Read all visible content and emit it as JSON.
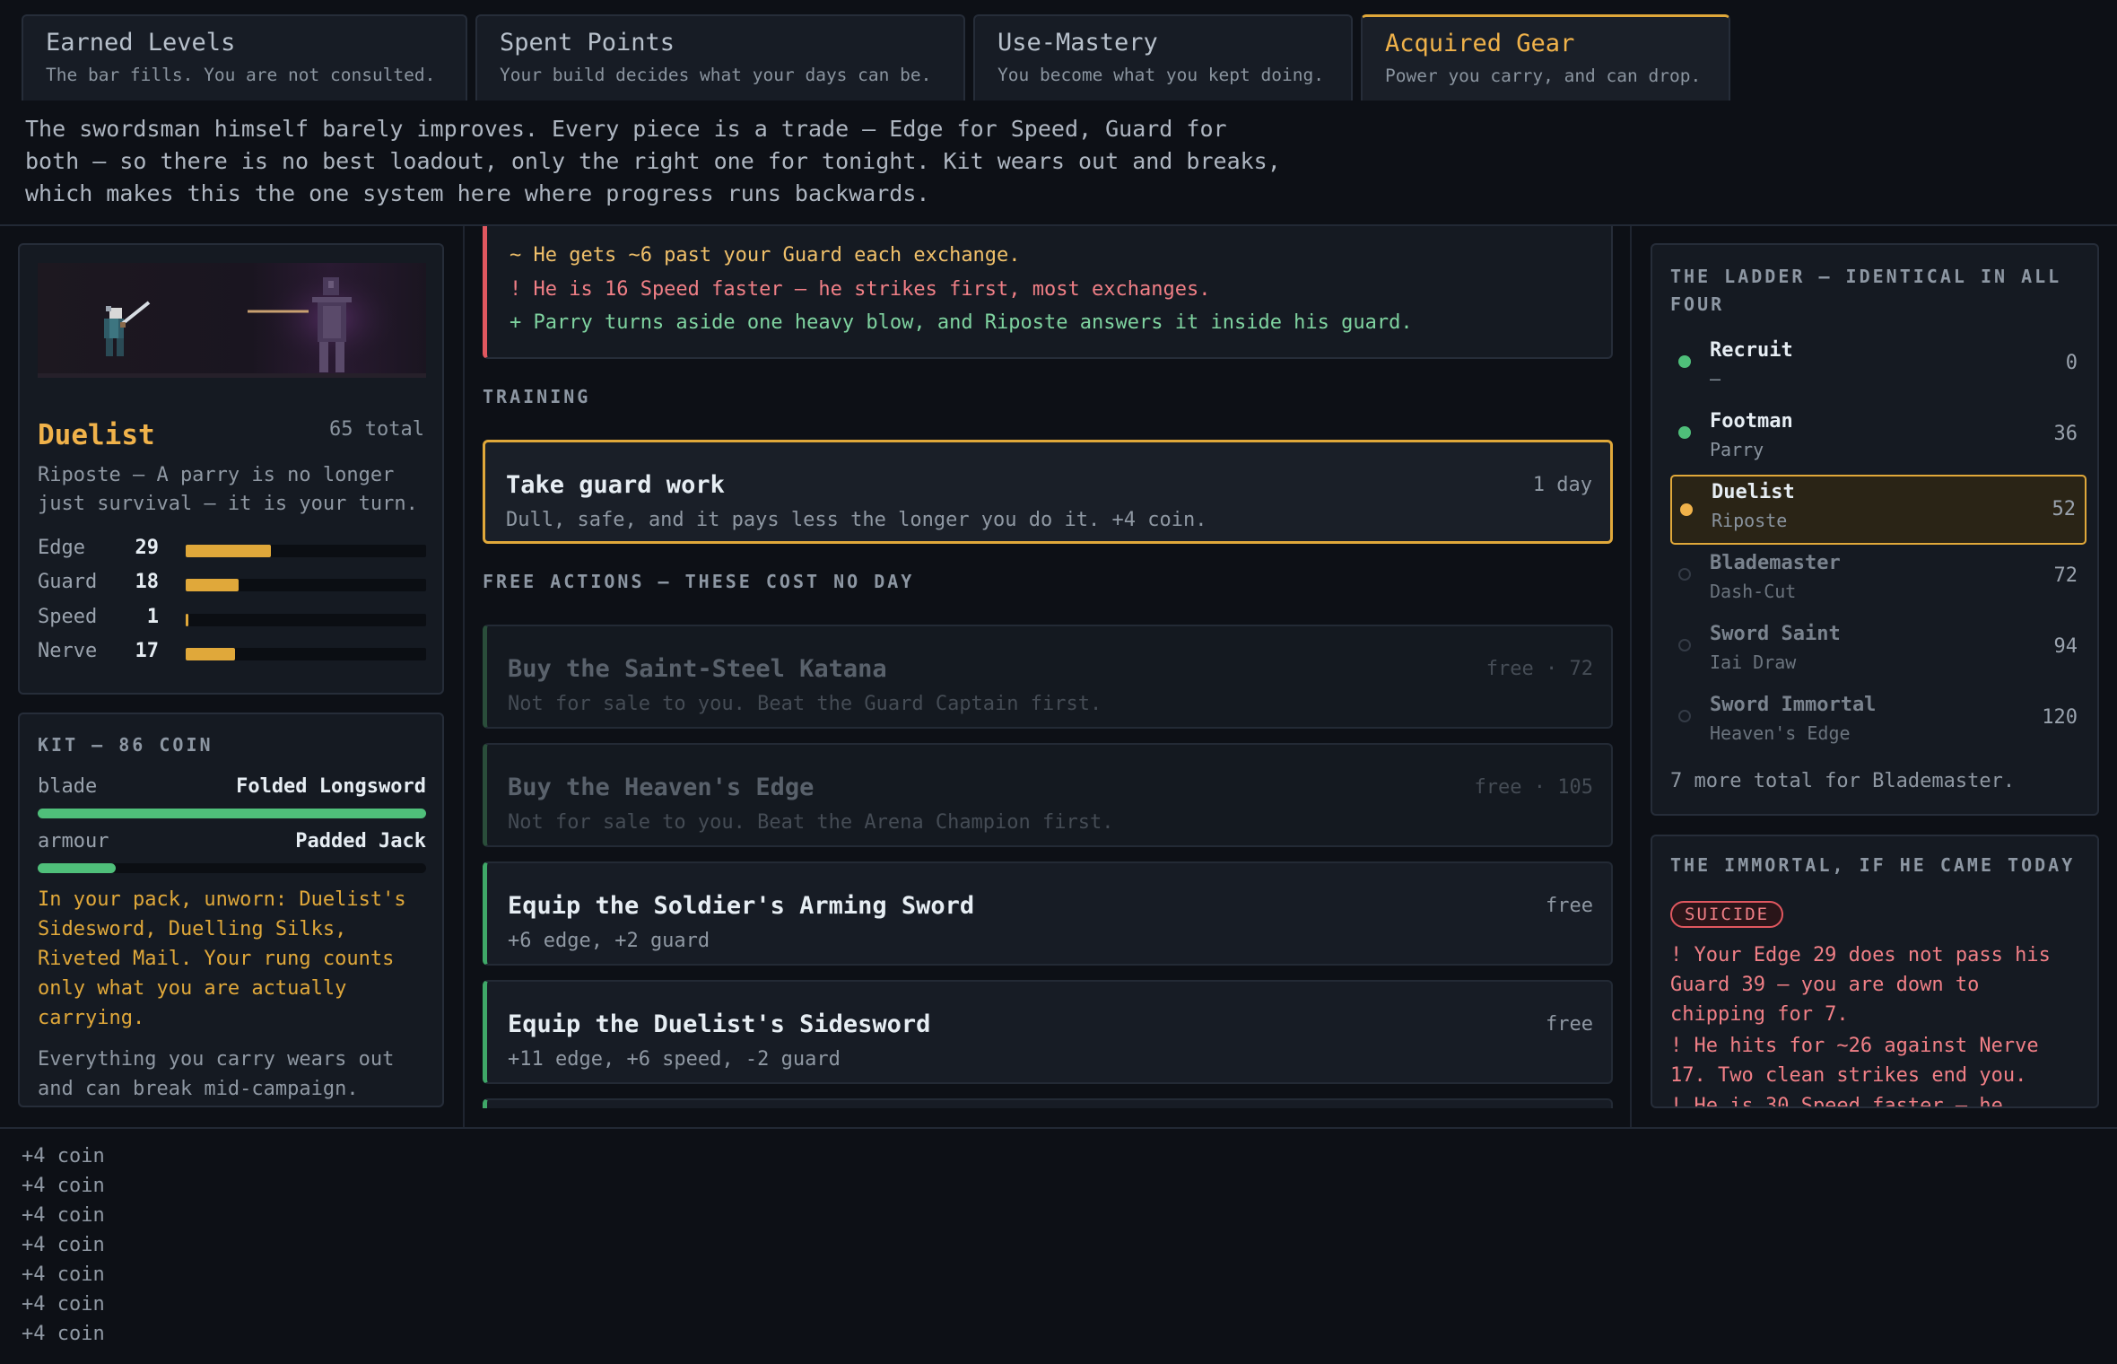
{
  "tabs": [
    {
      "title": "Earned Levels",
      "subtitle": "The bar fills. You are not consulted."
    },
    {
      "title": "Spent Points",
      "subtitle": "Your build decides what your days can be."
    },
    {
      "title": "Use-Mastery",
      "subtitle": "You become what you kept doing."
    },
    {
      "title": "Acquired Gear",
      "subtitle": "Power you carry, and can drop."
    }
  ],
  "intro": "The swordsman himself barely improves. Every piece is a trade — Edge for Speed, Guard for both — so there is no best loadout, only the right one for tonight. Kit wears out and breaks, which makes this the one system here where progress runs backwards.",
  "hero": {
    "name": "Duelist",
    "total": "65 total",
    "desc": "Riposte — A parry is no longer just survival — it is your turn.",
    "stats": [
      {
        "label": "Edge",
        "value": 29,
        "fill": 0.355
      },
      {
        "label": "Guard",
        "value": 18,
        "fill": 0.22
      },
      {
        "label": "Speed",
        "value": 1,
        "fill": 0.012
      },
      {
        "label": "Nerve",
        "value": 17,
        "fill": 0.205
      }
    ]
  },
  "kit": {
    "title": "KIT — 86 COIN",
    "slots": [
      {
        "label": "blade",
        "item": "Folded Longsword",
        "condition": 1.0
      },
      {
        "label": "armour",
        "item": "Padded Jack",
        "condition": 0.2
      }
    ],
    "pack": "In your pack, unworn: Duelist's Sidesword, Duelling Silks, Riveted Mail. Your rung counts only what you are actually carrying.",
    "note": "Everything you carry wears out and can break mid-campaign."
  },
  "threat": [
    {
      "text": "~ He gets ~6 past your Guard each exchange.",
      "tone": "amber"
    },
    {
      "text": "! He is 16 Speed faster — he strikes first, most exchanges.",
      "tone": "red"
    },
    {
      "text": "+ Parry turns aside one heavy blow, and Riposte answers it inside his guard.",
      "tone": "green"
    }
  ],
  "training_label": "TRAINING",
  "training": {
    "name": "Take guard work",
    "meta": "1 day",
    "desc": "Dull, safe, and it pays less the longer you do it. +4 coin."
  },
  "free_label": "FREE ACTIONS — THESE COST NO DAY",
  "free_actions": [
    {
      "name": "Buy the Saint-Steel Katana",
      "meta": "free · 72",
      "desc": "Not for sale to you. Beat the Guard Captain first.",
      "state": "locked"
    },
    {
      "name": "Buy the Heaven's Edge",
      "meta": "free · 105",
      "desc": "Not for sale to you. Beat the Arena Champion first.",
      "state": "locked"
    },
    {
      "name": "Equip the Soldier's Arming Sword",
      "meta": "free",
      "desc": "+6 edge, +2 guard",
      "state": "ok"
    },
    {
      "name": "Equip the Duelist's Sidesword",
      "meta": "free",
      "desc": "+11 edge, +6 speed, -2 guard",
      "state": "ok"
    }
  ],
  "ladder": {
    "title": "THE LADDER — IDENTICAL IN ALL FOUR",
    "rungs": [
      {
        "name": "Recruit",
        "skill": "—",
        "value": "0",
        "state": "done"
      },
      {
        "name": "Footman",
        "skill": "Parry",
        "value": "36",
        "state": "done"
      },
      {
        "name": "Duelist",
        "skill": "Riposte",
        "value": "52",
        "state": "current"
      },
      {
        "name": "Blademaster",
        "skill": "Dash-Cut",
        "value": "72",
        "state": "locked"
      },
      {
        "name": "Sword Saint",
        "skill": "Iai Draw",
        "value": "94",
        "state": "locked"
      },
      {
        "name": "Sword Immortal",
        "skill": "Heaven's Edge",
        "value": "120",
        "state": "locked"
      }
    ],
    "more": "7 more total for Blademaster."
  },
  "immortal": {
    "title": "THE IMMORTAL, IF HE CAME TODAY",
    "badge": "SUICIDE",
    "lines": [
      "! Your Edge 29 does not pass his Guard 39 — you are down to chipping for 7.",
      "! He hits for ~26 against Nerve 17. Two clean strikes end you.",
      "! He is 30 Speed faster — he"
    ]
  },
  "log": [
    "+4 coin",
    "+4 coin",
    "+4 coin",
    "+4 coin",
    "+4 coin",
    "+4 coin",
    "+4 coin"
  ],
  "colors": {
    "accent": "#e0a83a",
    "good": "#4fbf7a",
    "danger": "#e0575f"
  }
}
